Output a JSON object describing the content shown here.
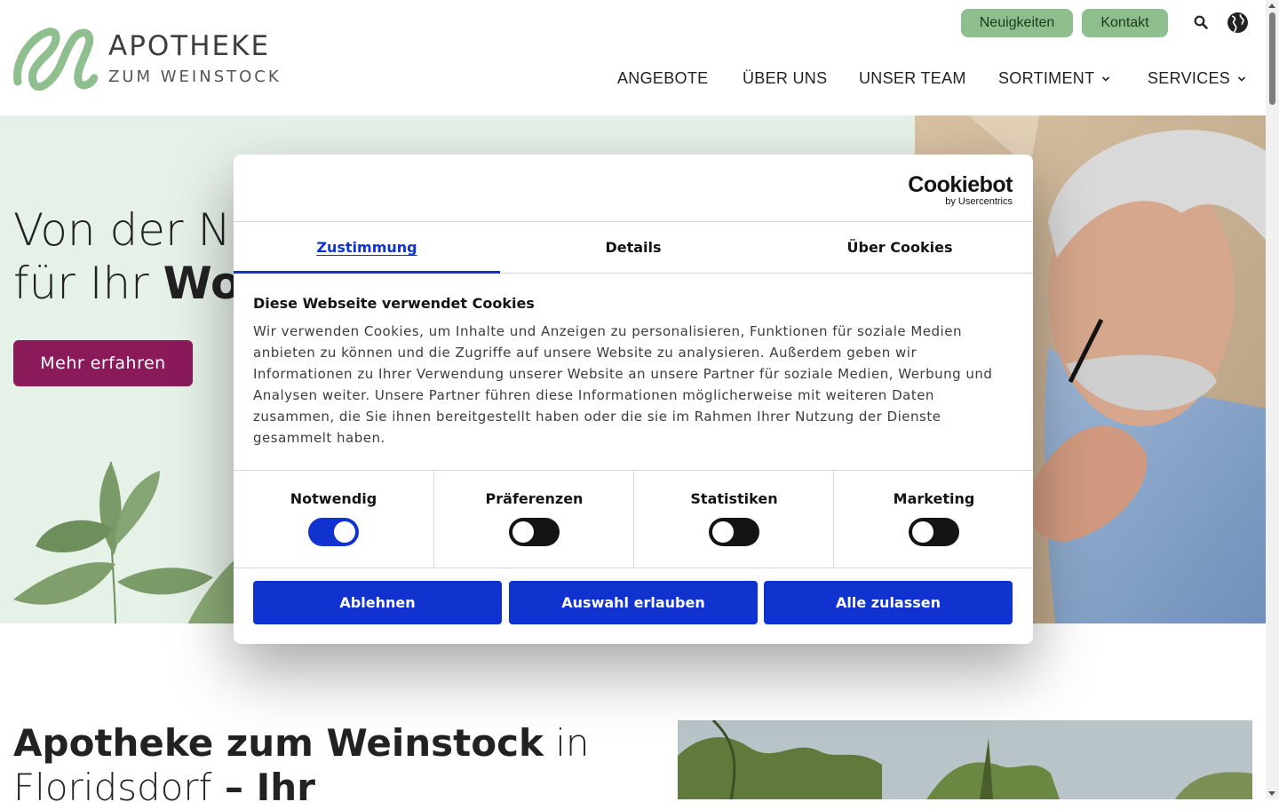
{
  "header": {
    "logo": {
      "title": "APOTHEKE",
      "subtitle": "ZUM WEINSTOCK"
    },
    "top_buttons": {
      "news": "Neuigkeiten",
      "contact": "Kontakt"
    },
    "icons": {
      "search": "search-icon",
      "language": "globe-icon"
    },
    "nav": [
      {
        "label": "ANGEBOTE",
        "has_dropdown": false
      },
      {
        "label": "ÜBER UNS",
        "has_dropdown": false
      },
      {
        "label": "UNSER TEAM",
        "has_dropdown": false
      },
      {
        "label": "SORTIMENT",
        "has_dropdown": true
      },
      {
        "label": "SERVICES",
        "has_dropdown": true
      }
    ]
  },
  "hero": {
    "line1": "Von der Na",
    "line2_light": "für Ihr ",
    "line2_bold": "Woh",
    "button": "Mehr erfahren",
    "bg_color": "#e6f1e7",
    "button_color": "#8b1a5b"
  },
  "intro": {
    "bold1": "Apotheke zum Weinstock",
    "light1": " in",
    "light2": "Floridsdorf",
    "bold2": " – Ihr"
  },
  "cookie_dialog": {
    "brand": "Cookiebot",
    "brand_sub": "by Usercentrics",
    "tabs": [
      "Zustimmung",
      "Details",
      "Über Cookies"
    ],
    "active_tab": "Zustimmung",
    "title": "Diese Webseite verwendet Cookies",
    "body": "Wir verwenden Cookies, um Inhalte und Anzeigen zu personalisieren, Funktionen für soziale Medien anbieten zu können und die Zugriffe auf unsere Website zu analysieren. Außerdem geben wir Informationen zu Ihrer Verwendung unserer Website an unsere Partner für soziale Medien, Werbung und Analysen weiter. Unsere Partner führen diese Informationen möglicherweise mit weiteren Daten zusammen, die Sie ihnen bereitgestellt haben oder die sie im Rahmen Ihrer Nutzung der Dienste gesammelt haben.",
    "categories": [
      {
        "label": "Notwendig",
        "enabled": true
      },
      {
        "label": "Präferenzen",
        "enabled": false
      },
      {
        "label": "Statistiken",
        "enabled": false
      },
      {
        "label": "Marketing",
        "enabled": false
      }
    ],
    "buttons": {
      "decline": "Ablehnen",
      "allow_selection": "Auswahl erlauben",
      "allow_all": "Alle zulassen"
    },
    "accent_color": "#1032cf"
  }
}
